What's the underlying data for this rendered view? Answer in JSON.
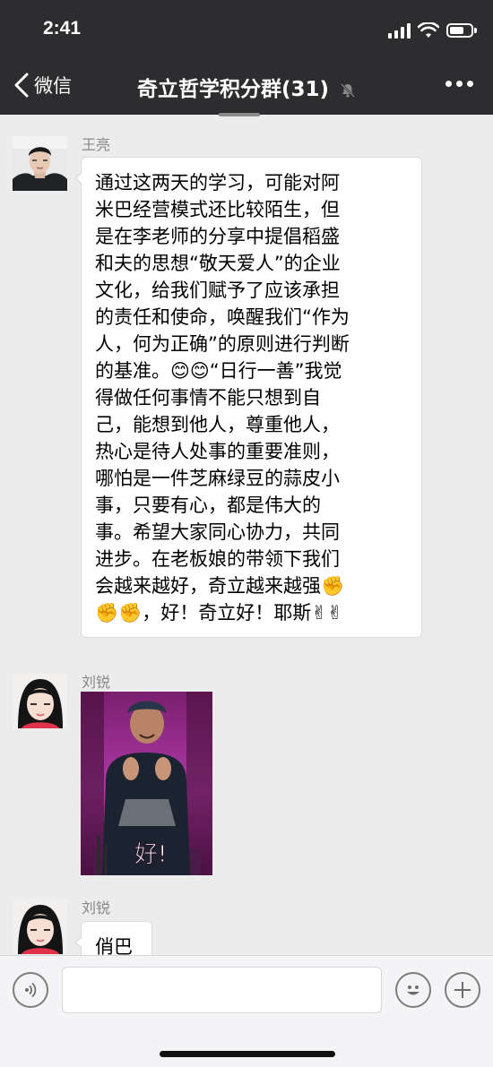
{
  "status_bar": {
    "time": "2:41"
  },
  "nav": {
    "back_label": "微信",
    "title": "奇立哲学积分群(31)"
  },
  "messages": [
    {
      "sender": "王亮",
      "text": "通过这两天的学习，可能对阿\n米巴经营模式还比较陌生，但\n是在李老师的分享中提倡稻盛\n和夫的思想“敬天爱人”的企业\n文化，给我们赋予了应该承担\n的责任和使命，唤醒我们“作为\n人，何为正确”的原则进行判断\n的基准。😊😊“日行一善”我觉\n得做任何事情不能只想到自\n己，能想到他人，尊重他人，\n热心是待人处事的重要准则，\n哪怕是一件芝麻绿豆的蒜皮小\n事，只要有心，都是伟大的\n事。希望大家同心协力，共同\n进步。在老板娘的带领下我们\n会越来越好，奇立越来越强✊\n✊✊，好！奇立好！耶斯✌✌"
    },
    {
      "sender": "刘锐",
      "sticker_caption": "好!"
    },
    {
      "sender": "刘锐",
      "text": "俏巴"
    }
  ],
  "input": {
    "placeholder": ""
  },
  "icons": {
    "back": "chevron-left-icon",
    "mute": "mute-bell-icon",
    "more": "more-dots-icon",
    "voice": "voice-icon",
    "emoji": "emoji-icon",
    "plus": "plus-icon"
  },
  "colors": {
    "nav_bg": "#2d2d2f",
    "chat_bg": "#ececec",
    "bubble_bg": "#ffffff",
    "input_bar_bg": "#f4f4f6"
  }
}
